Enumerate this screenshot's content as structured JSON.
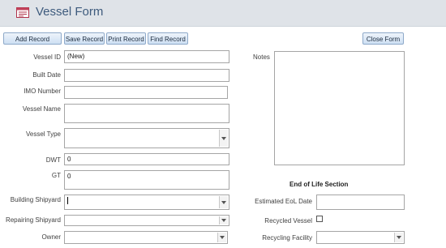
{
  "header": {
    "title": "Vessel Form",
    "icon": "form-icon"
  },
  "toolbar": {
    "add_record": "Add Record",
    "save_record": "Save Record",
    "print_record": "Print Record",
    "find_record": "Find Record",
    "close_form": "Close Form"
  },
  "fields": {
    "vessel_id": {
      "label": "Vessel ID",
      "value": "(New)"
    },
    "built_date": {
      "label": "Built Date",
      "value": ""
    },
    "imo_number": {
      "label": "IMO Number",
      "value": ""
    },
    "vessel_name": {
      "label": "Vessel Name",
      "value": ""
    },
    "vessel_type": {
      "label": "Vessel Type",
      "value": ""
    },
    "dwt": {
      "label": "DWT",
      "value": "0"
    },
    "gt": {
      "label": "GT",
      "value": "0"
    },
    "building_shipyard": {
      "label": "Building Shipyard",
      "value": ""
    },
    "repairing_shipyard": {
      "label": "Repairing Shipyard",
      "value": ""
    },
    "owner": {
      "label": "Owner",
      "value": ""
    },
    "notes": {
      "label": "Notes",
      "value": ""
    }
  },
  "end_of_life": {
    "section_title": "End of Life Section",
    "estimated_eol_date": {
      "label": "Estimated EoL Date",
      "value": ""
    },
    "recycled_vessel": {
      "label": "Recycled Vessel",
      "checked": false
    },
    "recycling_facility": {
      "label": "Recycling Facility",
      "value": ""
    }
  }
}
